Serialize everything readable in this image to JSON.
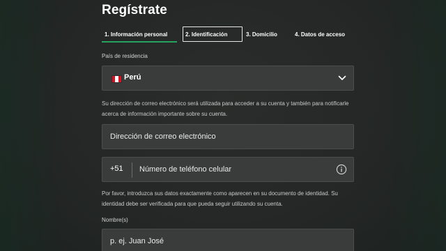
{
  "page": {
    "title": "Regístrate"
  },
  "steps": [
    {
      "label": "1. Información personal",
      "state": "active"
    },
    {
      "label": "2. Identificación",
      "state": "focused"
    },
    {
      "label": "3. Domicilio",
      "state": "upcoming"
    },
    {
      "label": "4. Datos de acceso",
      "state": "upcoming"
    }
  ],
  "country": {
    "label": "País de residencia",
    "value": "Perú",
    "flag_icon": "peru-flag-icon"
  },
  "email": {
    "helper": "Su dirección de correo electrónico será utilizada para acceder a su cuenta y también para notificarle acerca de información importante sobre su cuenta.",
    "placeholder": "Dirección de correo electrónico"
  },
  "phone": {
    "prefix": "+51",
    "placeholder": "Número de teléfono celular",
    "info_icon": "info-icon"
  },
  "identity": {
    "helper": "Por favor, introduzca sus datos exactamente como aparecen en su documento de identidad. Su identidad debe ser verificada para que pueda seguir utilizando su cuenta."
  },
  "name": {
    "label": "Nombre(s)",
    "placeholder": "p. ej. Juan José"
  },
  "colors": {
    "accent": "#27a35f",
    "field_bg": "#3a3c3b",
    "field_border": "#4b4e4c",
    "background": "#242726"
  }
}
